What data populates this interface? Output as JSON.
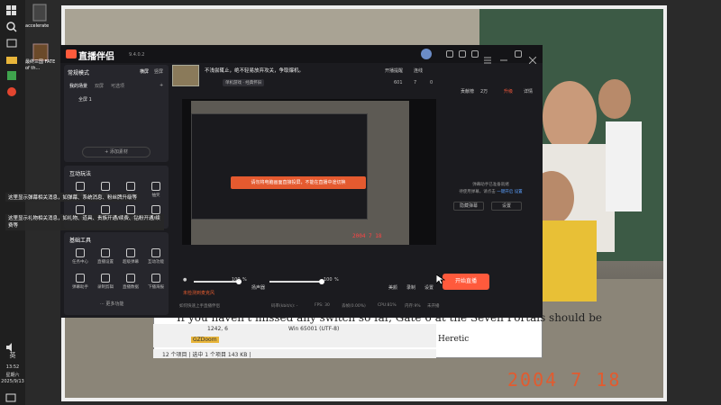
{
  "taskbar": {
    "search_icon": "search-icon",
    "clock_time": "13:52",
    "clock_day": "星期六",
    "clock_date": "2025/9/13",
    "ime": "英",
    "volume_icon": "volume-icon"
  },
  "desktop": {
    "icons": [
      {
        "label": "accelerate"
      },
      {
        "label": "最终三国 FATE of th..."
      }
    ]
  },
  "app": {
    "title": "直播伴侣",
    "version": "9.4.0.2",
    "slogan": "不浅尝辄止，绝不轻易放弃攻关，争取爆机。",
    "categories": [
      "单机游戏 · 经典怀旧"
    ],
    "stats": {
      "hot": "601",
      "users": "7",
      "likes": "0"
    },
    "top_buttons": [
      "开播提醒",
      "连线"
    ],
    "top_right": {
      "label1": "贡献榜",
      "label2": "2万",
      "label3": "升级",
      "label4": "详情"
    }
  },
  "sidebar": {
    "mode_label": "常规模式",
    "mode_tabs": [
      "横屏",
      "竖屏"
    ],
    "scene_label": "我的场景",
    "scene_tabs": [
      "双屏",
      "可选项"
    ],
    "scene_items": [
      "全屏 1"
    ],
    "add_source": "+ 添加素材",
    "interactive_title": "互动玩法",
    "interactive_items": [
      "弹幕",
      "礼物",
      "贴纸",
      "抽奖",
      "投票",
      "PK",
      "连麦",
      "更多"
    ],
    "tools_title": "基础工具",
    "tools_items": [
      "任务中心",
      "直播设置",
      "超级弹幕",
      "互动功能",
      "弹幕助手",
      "录制剪辑",
      "直播数据",
      "下播海报"
    ],
    "more_label": "··· 更多功能"
  },
  "preview": {
    "warning": "请勿将电脑画面直接投屏，不能在直播中途切换",
    "inner_date": "2004 7 18"
  },
  "controls": {
    "mic_label": "麦克风",
    "mic_volume": 100,
    "speaker_label": "扬声器",
    "speaker_volume": 100,
    "beauty_label": "美颜",
    "record_label": "录制",
    "settings_label": "设置",
    "go_live": "开始直播",
    "unavailable": "未检测到麦克风"
  },
  "status": {
    "tip": "如何快速上手直播伴侣",
    "bitrate": "码率(kbit/s): -",
    "fps": "FPS: 30",
    "dropped": "丢帧(0.00%)",
    "cpu": "CPU:81%",
    "mem": "内存:9%",
    "net": "未开播"
  },
  "right_panel": {
    "line1": "弹幕助手已准备就绪",
    "line2": "待使用弹幕，请点击",
    "link1": "一键开启",
    "link2": "设置",
    "btn1": "隐藏弹幕",
    "btn2": "设置"
  },
  "tooltips": {
    "t1": "这里显示弹幕相关消息，如弹幕、系统消息、粉丝牌升级等",
    "t2": "这里显示礼物相关消息，如礼物、道具、贵族开通/续费、钻粉开通/续费等"
  },
  "background_app": {
    "text_line": "If you haven't missed any switch so far, Gate 6 at the Seven Portals should be",
    "status_pos": "1242, 6",
    "status_enc": "Win  65001 (UTF-8)",
    "folder": "GZDoom",
    "selection": "12 个项目  |  选中 1 个项目 143 KB  |",
    "side_label": "Heretic"
  },
  "photo": {
    "date_stamp": "2004  7  18"
  },
  "colors": {
    "accent": "#ff5a3c",
    "bg": "#1b1b1f"
  }
}
